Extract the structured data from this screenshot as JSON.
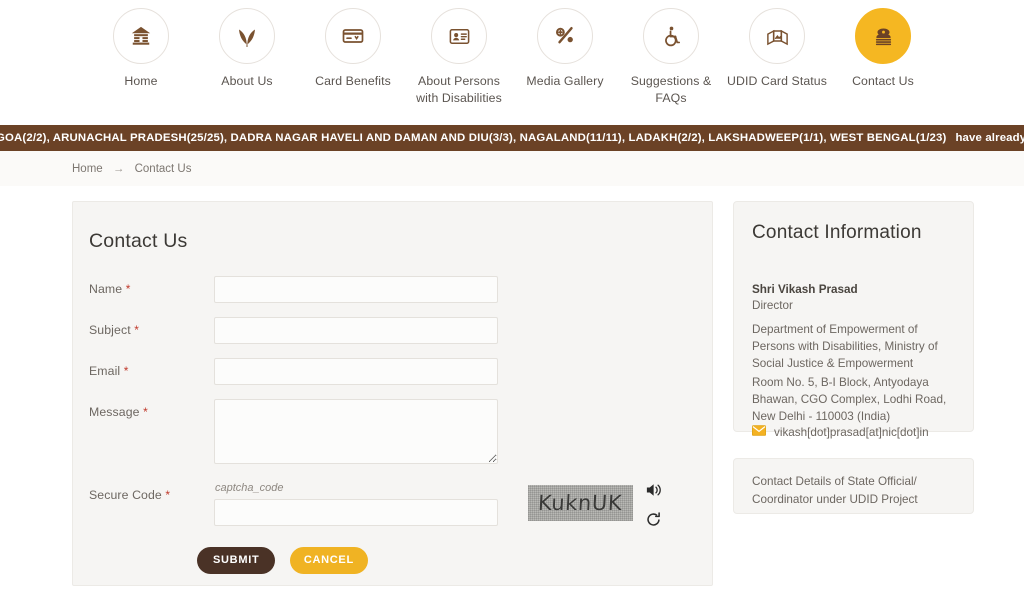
{
  "nav": {
    "items": [
      {
        "label": "Home",
        "icon": "home-icon",
        "active": false
      },
      {
        "label": "About Us",
        "icon": "leaf-icon",
        "active": false
      },
      {
        "label": "Card Benefits",
        "icon": "card-icon",
        "active": false
      },
      {
        "label": "About Persons with Disabilities",
        "icon": "id-card-icon",
        "active": false
      },
      {
        "label": "Media Gallery",
        "icon": "media-icon",
        "active": false
      },
      {
        "label": "Suggestions & FAQs",
        "icon": "wheelchair-icon",
        "active": false
      },
      {
        "label": "UDID Card Status",
        "icon": "cards-stack-icon",
        "active": false
      },
      {
        "label": "Contact Us",
        "icon": "telephone-icon",
        "active": true
      }
    ]
  },
  "ticker": {
    "text": "GOA(2/2), ARUNACHAL PRADESH(25/25), DADRA NAGAR HAVELI AND DAMAN AND DIU(3/3), NAGALAND(11/11), LADAKH(2/2), LAKSHADWEEP(1/1), WEST BENGAL(1/23)",
    "tail": "have already started generating UDID",
    "background": "#6b4226",
    "color": "#ffffff"
  },
  "breadcrumb": {
    "home": "Home",
    "separator": "→",
    "current": "Contact Us"
  },
  "form": {
    "title": "Contact Us",
    "fields": [
      {
        "label": "Name",
        "required": "*",
        "value": "",
        "placeholder": ""
      },
      {
        "label": "Subject",
        "required": "*",
        "value": "",
        "placeholder": ""
      },
      {
        "label": "Email",
        "required": "*",
        "value": "",
        "placeholder": ""
      },
      {
        "label": "Message",
        "required": "*",
        "value": "",
        "placeholder": ""
      },
      {
        "label": "Secure Code",
        "required": "*",
        "value": "",
        "placeholder": ""
      }
    ],
    "captcha": {
      "hint": "captcha_code",
      "image_text": "KuknUK",
      "audio_icon": "speaker-icon",
      "refresh_icon": "refresh-icon"
    },
    "buttons": {
      "submit": "SUBMIT",
      "cancel": "CANCEL",
      "submit_color": "#4a3226",
      "cancel_color": "#f0b323"
    }
  },
  "sidebar": {
    "info": {
      "title": "Contact Information",
      "name": "Shri Vikash Prasad",
      "role": "Director",
      "department": "Department of Empowerment of Persons with Disabilities, Ministry of Social Justice & Empowerment",
      "address": "Room No. 5, B-I Block, Antyodaya Bhawan, CGO Complex, Lodhi Road, New Delhi - 110003 (India)",
      "email": "vikash[dot]prasad[at]nic[dot]in",
      "email_icon": "envelope-icon"
    },
    "link_card": {
      "text": "Contact Details of State Official/ Coordinator under UDID Project"
    }
  },
  "theme": {
    "accent_yellow": "#f5b722",
    "accent_brown": "#6b4226",
    "panel_bg": "#f6f5f3"
  }
}
